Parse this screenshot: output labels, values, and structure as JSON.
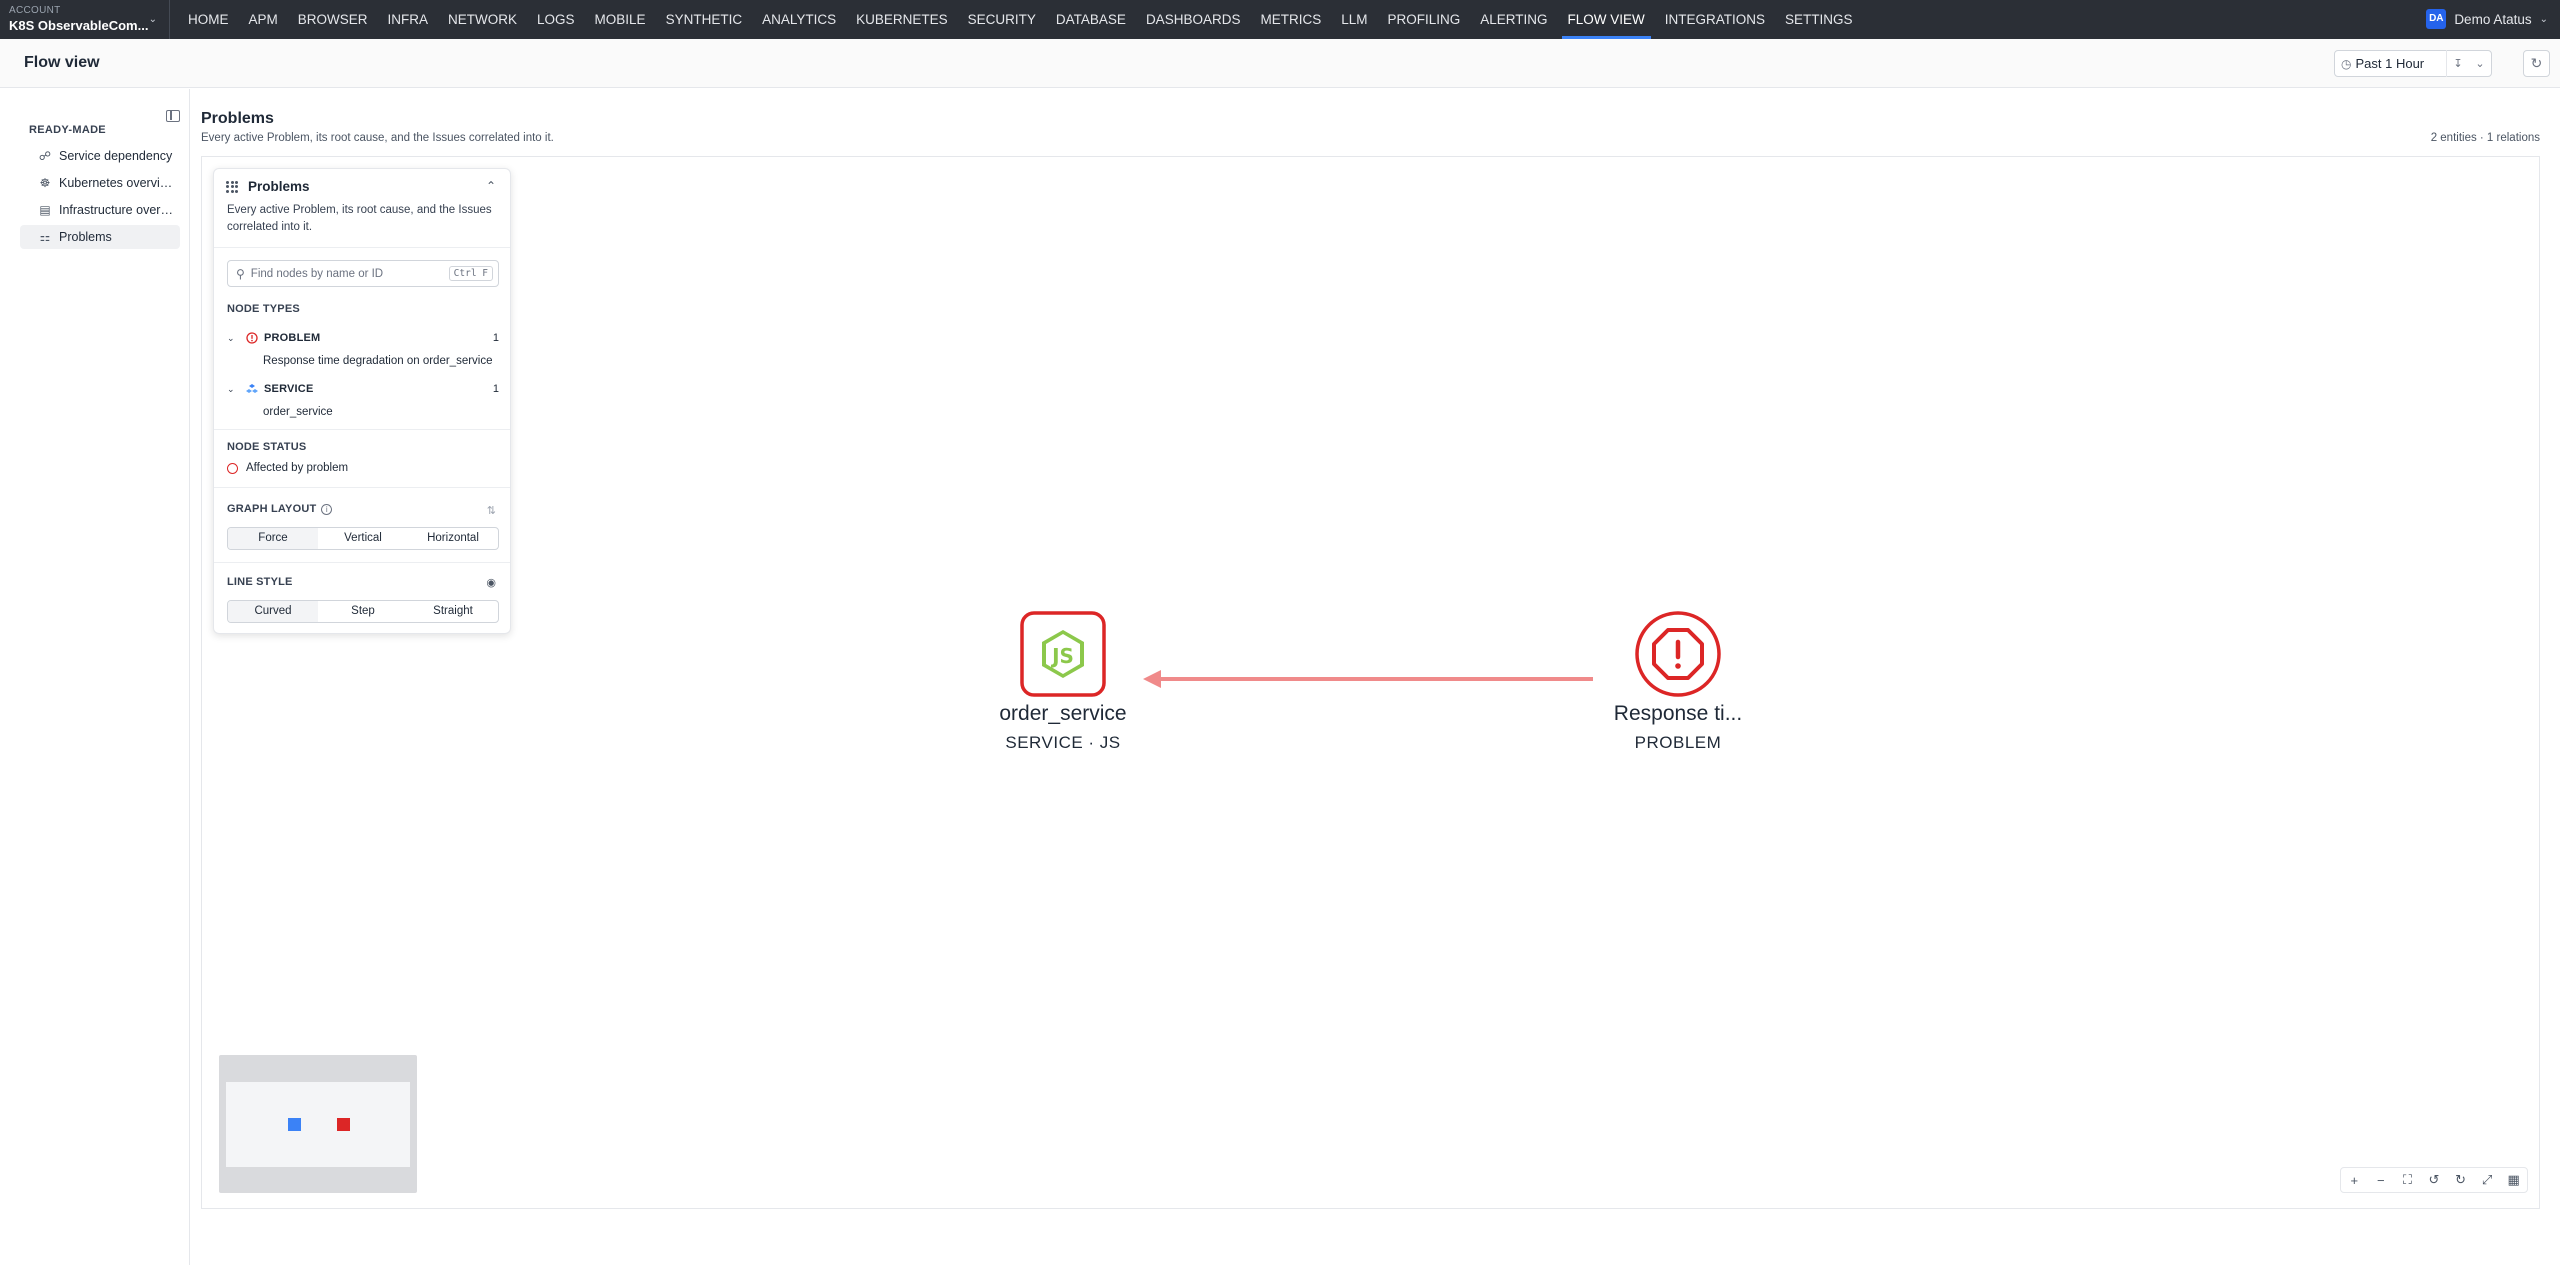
{
  "account": {
    "label": "ACCOUNT",
    "name": "K8S ObservableCom..."
  },
  "nav": {
    "items": [
      "HOME",
      "APM",
      "BROWSER",
      "INFRA",
      "NETWORK",
      "LOGS",
      "MOBILE",
      "SYNTHETIC",
      "ANALYTICS",
      "KUBERNETES",
      "SECURITY",
      "DATABASE",
      "DASHBOARDS",
      "METRICS",
      "LLM",
      "PROFILING",
      "ALERTING",
      "FLOW VIEW",
      "INTEGRATIONS",
      "SETTINGS"
    ],
    "active": "FLOW VIEW"
  },
  "user": {
    "initials": "DA",
    "name": "Demo Atatus"
  },
  "header": {
    "title": "Flow view",
    "time_range": "Past 1 Hour"
  },
  "sidebar": {
    "heading": "READY-MADE",
    "items": [
      {
        "label": "Service dependency",
        "icon": "share-icon"
      },
      {
        "label": "Kubernetes overview",
        "icon": "kubernetes-icon"
      },
      {
        "label": "Infrastructure overview",
        "icon": "server-icon"
      },
      {
        "label": "Problems",
        "icon": "graph-icon",
        "active": true
      }
    ]
  },
  "main": {
    "title": "Problems",
    "subtitle": "Every active Problem, its root cause, and the Issues correlated into it.",
    "counts": "2 entities · 1 relations"
  },
  "panel": {
    "title": "Problems",
    "description": "Every active Problem, its root cause, and the Issues correlated into it.",
    "search_placeholder": "Find nodes by name or ID",
    "search_shortcut": "Ctrl F",
    "node_types_heading": "NODE TYPES",
    "node_types": [
      {
        "label": "PROBLEM",
        "count": "1",
        "child": "Response time degradation on order_service",
        "icon": "alert-circle-icon"
      },
      {
        "label": "SERVICE",
        "count": "1",
        "child": "order_service",
        "icon": "service-cubes-icon"
      }
    ],
    "node_status_heading": "NODE STATUS",
    "node_status": "Affected by problem",
    "graph_layout_heading": "GRAPH LAYOUT",
    "graph_layout_options": [
      "Force",
      "Vertical",
      "Horizontal"
    ],
    "graph_layout_selected": "Force",
    "line_style_heading": "LINE STYLE",
    "line_style_options": [
      "Curved",
      "Step",
      "Straight"
    ],
    "line_style_selected": "Curved"
  },
  "graph": {
    "nodes": [
      {
        "label": "order_service",
        "sub": "SERVICE · JS",
        "icon": "nodejs-icon",
        "color": "#dc2626"
      },
      {
        "label": "Response ti...",
        "sub": "PROBLEM",
        "icon": "octagon-alert-icon",
        "color": "#dc2626"
      }
    ],
    "edge_color": "#f08a8a"
  },
  "minimap": {
    "colors": [
      "#3b82f6",
      "#dc2626"
    ]
  },
  "colors": {
    "accent": "#3b82f6",
    "problem": "#dc2626",
    "nodejs": "#8cc84b"
  }
}
